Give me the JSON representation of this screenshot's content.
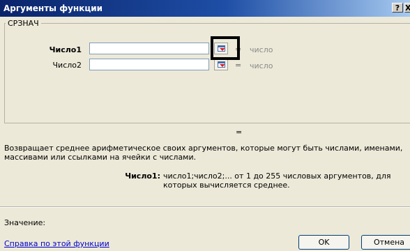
{
  "window": {
    "title": "Аргументы функции",
    "help_button": "?",
    "close_button": "X"
  },
  "function_group": {
    "name": "СРЗНАЧ",
    "args": [
      {
        "label": "Число1",
        "value": "",
        "equals": "=",
        "result": "число",
        "bold": true
      },
      {
        "label": "Число2",
        "value": "",
        "equals": "=",
        "result": "число",
        "bold": false
      }
    ]
  },
  "formula_result_equals": "=",
  "description": "Возвращает среднее арифметическое своих аргументов, которые могут быть числами, именами, массивами или ссылками на ячейки с числами.",
  "arg_help": {
    "label": "Число1:",
    "text": "число1;число2;... от 1 до 255 числовых аргументов, для которых вычисляется среднее."
  },
  "value_label": "Значение:",
  "help_link": "Справка по этой функции",
  "buttons": {
    "ok": "OK",
    "cancel": "Отмена"
  },
  "colors": {
    "dialog_bg": "#ece9d8",
    "title_start": "#0a246a",
    "link": "#0000cc",
    "highlight_frame": "#000000"
  }
}
